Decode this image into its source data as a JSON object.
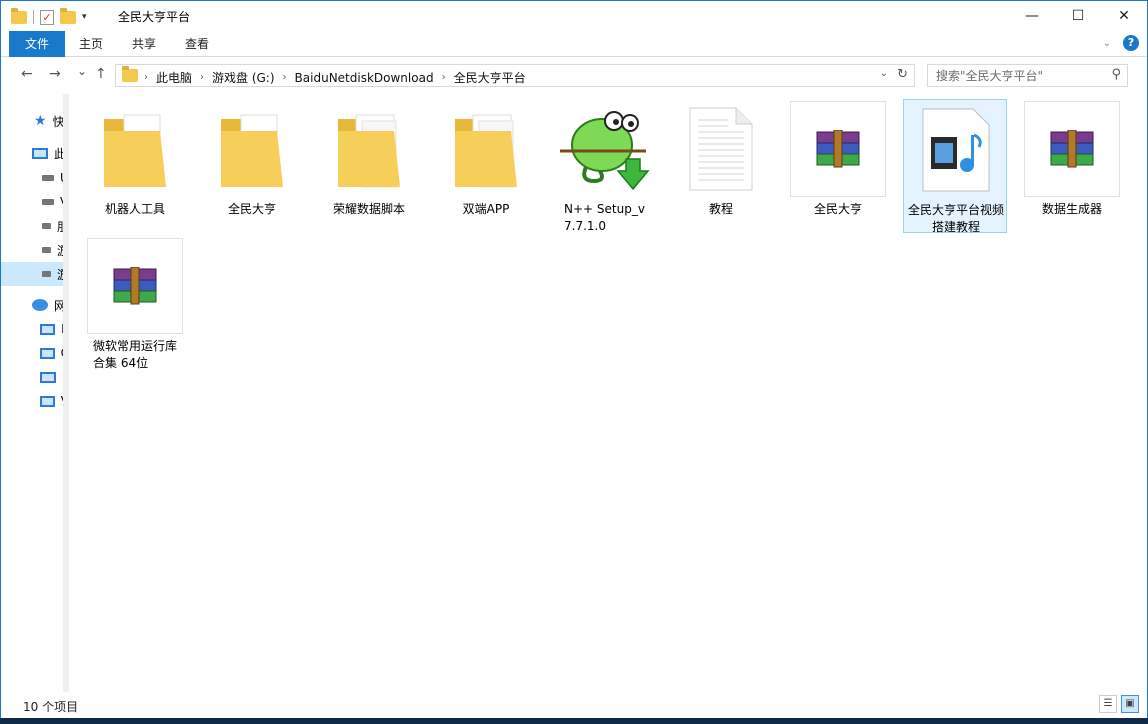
{
  "window": {
    "title": "全民大亨平台",
    "qat_dropdown": "▾",
    "min": "—",
    "max": "☐",
    "close": "✕"
  },
  "ribbon": {
    "tabs": [
      "文件",
      "主页",
      "共享",
      "查看"
    ]
  },
  "nav": {
    "back": "←",
    "forward": "→",
    "recent": "⌄",
    "up": "↑",
    "breadcrumbs": [
      "此电脑",
      "游戏盘 (G:)",
      "BaiduNetdiskDownload",
      "全民大亨平台"
    ],
    "search_placeholder": "搜索\"全民大亨平台\""
  },
  "sidebar": {
    "items": [
      {
        "label": "快",
        "icon": "star-icon"
      },
      {
        "label": "此",
        "icon": "pc-icon"
      },
      {
        "label": "U",
        "icon": "drive-icon"
      },
      {
        "label": "V",
        "icon": "drive-icon"
      },
      {
        "label": "朋",
        "icon": "drive-icon"
      },
      {
        "label": "游",
        "icon": "drive-icon"
      },
      {
        "label": "游",
        "icon": "drive-icon",
        "selected": true
      },
      {
        "label": "网",
        "icon": "network-icon"
      },
      {
        "label": "K",
        "icon": "pc-icon"
      },
      {
        "label": "C",
        "icon": "pc-icon"
      },
      {
        "label": "F",
        "icon": "pc-icon"
      },
      {
        "label": "V",
        "icon": "pc-icon"
      }
    ]
  },
  "files": [
    {
      "name": "机器人工具",
      "type": "folder"
    },
    {
      "name": "全民大亨",
      "type": "folder"
    },
    {
      "name": "荣耀数据脚本",
      "type": "folder"
    },
    {
      "name": "双端APP",
      "type": "folder"
    },
    {
      "name": "N++ Setup_v7.7.1.0",
      "type": "notepadpp-installer"
    },
    {
      "name": "教程",
      "type": "text-document"
    },
    {
      "name": "全民大亨",
      "type": "rar-archive"
    },
    {
      "name": "全民大亨平台视频搭建教程",
      "type": "video-file"
    },
    {
      "name": "数据生成器",
      "type": "rar-archive"
    },
    {
      "name": "微软常用运行库合集 64位",
      "type": "rar-archive"
    }
  ],
  "status": {
    "count": "10 个项目"
  },
  "colors": {
    "accent": "#1979ca",
    "folder": "#f2c94c",
    "selection": "#cce8ff"
  }
}
